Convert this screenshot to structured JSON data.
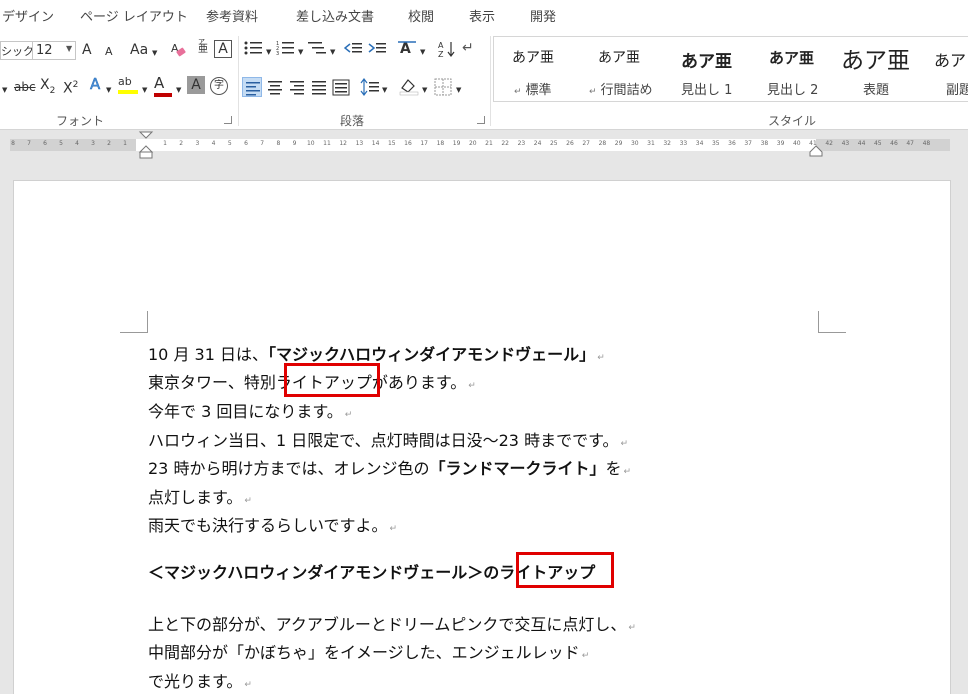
{
  "ribbon_tabs": [
    "デザイン",
    "ページ レイアウト",
    "参考資料",
    "差し込み文書",
    "校閲",
    "表示",
    "開発"
  ],
  "font": {
    "name_partial": "シック",
    "size": "12",
    "grow_icon": "A",
    "shrink_icon": "A",
    "case_icon": "Aa",
    "clear_format_icon": "eraser",
    "ruby_top": "ア",
    "ruby_bottom": "亜",
    "char_border_icon": "A",
    "strike_label": "abc",
    "subscript_base": "X",
    "subscript_mark": "2",
    "superscript_base": "X",
    "superscript_mark": "2",
    "effect_icon": "A",
    "highlight_label": "ab",
    "font_color_icon": "A",
    "shading_icon": "A",
    "enclose_icon": "字",
    "group_label": "フォント"
  },
  "paragraph": {
    "sort_icon": "A↓Z",
    "group_label": "段落"
  },
  "styles": {
    "group_label": "スタイル",
    "items": [
      {
        "sample": "あア亜",
        "name": "標準",
        "mark": "↵"
      },
      {
        "sample": "あア亜",
        "name": "行間詰め",
        "mark": "↵"
      },
      {
        "sample": "あア亜",
        "name": "見出し 1",
        "mark": ""
      },
      {
        "sample": "あア亜",
        "name": "見出し 2",
        "mark": ""
      },
      {
        "sample": "あア亜",
        "name": "表題",
        "mark": ""
      },
      {
        "sample": "あア",
        "name": "副題",
        "mark": ""
      }
    ]
  },
  "ruler": {
    "left_numbers": [
      "8",
      "7",
      "6",
      "5",
      "4",
      "3",
      "2",
      "1"
    ],
    "right_numbers": [
      "1",
      "2",
      "3",
      "4",
      "5",
      "6",
      "7",
      "8",
      "9",
      "10",
      "11",
      "12",
      "13",
      "14",
      "15",
      "16",
      "17",
      "18",
      "19",
      "20",
      "21",
      "22",
      "23",
      "24",
      "25",
      "26",
      "27",
      "28",
      "29",
      "30",
      "31",
      "32",
      "33",
      "34",
      "35",
      "36",
      "37",
      "38",
      "39",
      "40",
      "41",
      "42",
      "43",
      "44",
      "45",
      "46",
      "47",
      "48"
    ]
  },
  "document": {
    "paragraph_mark": "↵",
    "lines": [
      {
        "parts": [
          {
            "text": "10 月 31 日は、",
            "bold": false
          },
          {
            "text": "「マジックハロウィンダイアモンドヴェール」",
            "bold": true
          }
        ]
      },
      {
        "parts": [
          {
            "text": "東京タワー、特別",
            "bold": false
          },
          {
            "text": "ライトアップ",
            "bold": false
          },
          {
            "text": "があります。",
            "bold": false
          }
        ]
      },
      {
        "parts": [
          {
            "text": "今年で 3 回目になります。",
            "bold": false
          }
        ]
      },
      {
        "parts": [
          {
            "text": "ハロウィン当日、1 日限定で、点灯時間は日没～23 時までです。",
            "bold": false
          }
        ]
      },
      {
        "parts": [
          {
            "text": "23 時から明け方までは、オレンジ色の",
            "bold": false
          },
          {
            "text": "「ランドマークライト」",
            "bold": true
          },
          {
            "text": "を",
            "bold": false
          }
        ]
      },
      {
        "parts": [
          {
            "text": "点灯します。",
            "bold": false
          }
        ]
      },
      {
        "parts": [
          {
            "text": "雨天でも決行するらしいですよ。",
            "bold": false
          }
        ]
      },
      {
        "parts": [
          {
            "text": "＜マジックハロウィンダイアモンドヴェール＞の",
            "bold": true
          },
          {
            "text": "ライトアップ",
            "bold": true
          }
        ]
      },
      {
        "parts": [
          {
            "text": "上と下の部分が、アクアブルーとドリームピンクで交互に点灯し、",
            "bold": false
          }
        ]
      },
      {
        "parts": [
          {
            "text": "中間部分が「かぼちゃ」をイメージした、エンジェルレッド",
            "bold": false
          }
        ]
      },
      {
        "parts": [
          {
            "text": "で光ります。",
            "bold": false
          }
        ]
      }
    ]
  },
  "colors": {
    "highlight_box": "#e00000",
    "highlighter": "#ffff00",
    "font_color": "#c00000"
  }
}
